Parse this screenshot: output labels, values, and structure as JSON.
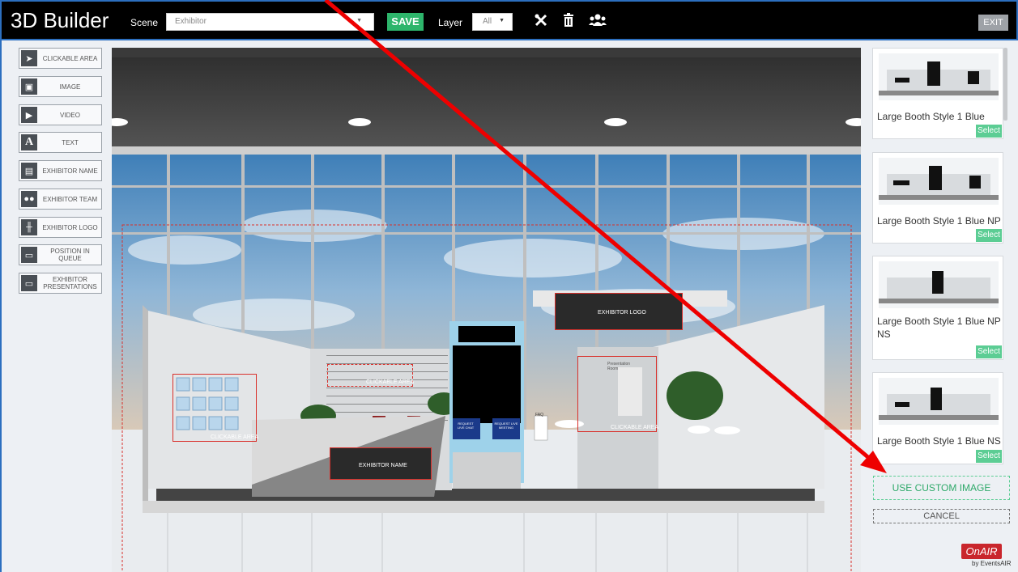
{
  "header": {
    "title": "3D Builder",
    "scene_label": "Scene",
    "scene_value": "Exhibitor",
    "save_label": "SAVE",
    "layer_label": "Layer",
    "layer_value": "All",
    "exit_label": "EXIT",
    "icons": [
      "tools-icon",
      "trash-icon",
      "users-icon"
    ]
  },
  "toolbox": [
    {
      "label": "CLICKABLE AREA",
      "icon": "cursor-icon"
    },
    {
      "label": "IMAGE",
      "icon": "image-icon"
    },
    {
      "label": "VIDEO",
      "icon": "video-icon"
    },
    {
      "label": "TEXT",
      "icon": "text-icon"
    },
    {
      "label": "EXHIBITOR NAME",
      "icon": "nameplate-icon"
    },
    {
      "label": "EXHIBITOR TEAM",
      "icon": "team-icon"
    },
    {
      "label": "EXHIBITOR LOGO",
      "icon": "logo-icon"
    },
    {
      "label": "POSITION IN QUEUE",
      "icon": "monitor-icon"
    },
    {
      "label": "EXHIBITOR PRESENTATIONS",
      "icon": "presentation-icon"
    }
  ],
  "canvas": {
    "overlays": {
      "exhibitor_logo": "EXHIBITOR LOGO",
      "exhibitor_name": "EXHIBITOR NAME",
      "clickable_area_1": "CLICKABLE AREA",
      "clickable_area_2": "CLICKABLE AREA",
      "clickable_area_3": "CLICKABLE AREA"
    },
    "booth_text": {
      "presentation_room": "Presentation Room",
      "faq": "FAQ",
      "request_chat": "REQUEST LIVE CHAT",
      "request_meeting": "REQUEST LIVE MEETING"
    }
  },
  "templates": [
    {
      "name": "Large Booth Style 1 Blue",
      "select_label": "Select"
    },
    {
      "name": "Large Booth Style 1 Blue NP",
      "select_label": "Select"
    },
    {
      "name": "Large Booth Style 1 Blue NP NS",
      "select_label": "Select"
    },
    {
      "name": "Large Booth Style 1 Blue NS",
      "select_label": "Select"
    }
  ],
  "actions": {
    "custom_image_label": "USE CUSTOM IMAGE",
    "cancel_label": "CANCEL"
  },
  "branding": {
    "logo_text": "OnAIR",
    "logo_sub": "by EventsAIR"
  },
  "colors": {
    "accent_green": "#2db56b",
    "select_green": "#5ccd94",
    "highlight_red": "#d9302b",
    "frame_blue": "#2c6fbf"
  }
}
